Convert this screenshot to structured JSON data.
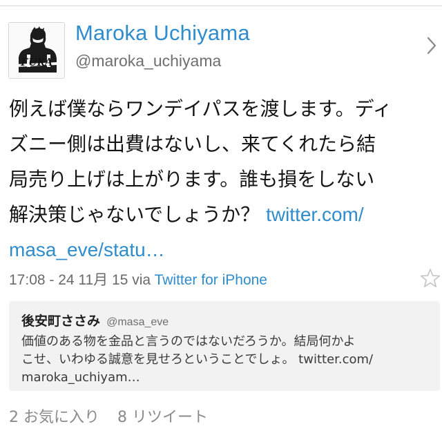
{
  "tweet": {
    "author_name": "Maroka Uchiyama",
    "author_handle": "@maroka_uchiyama",
    "text_lines": [
      "例えば僕ならワンデイパスを渡します。ディ",
      "ズニー側は出費はないし、来てくれたら結",
      "局売り上げは上がります。誰も損をしない",
      "解決策じゃないでしょうか？"
    ],
    "link_part1": "twitter.com/",
    "link_part2": "masa_eve/statu…",
    "timestamp": "17:08 - 24 11月 15",
    "via_label": "via",
    "via_app": "Twitter for iPhone"
  },
  "avatar": {
    "logo_text": "FUKA"
  },
  "quoted": {
    "name": "後安町ささみ",
    "handle": "@masa_eve",
    "text_lines": [
      "価値のある物を金品と言うのではないだろうか。結局何かよ",
      "こせ、いわゆる誠意を見せろということでしょ。 twitter.com/",
      "maroka_uchiyam…"
    ]
  },
  "stats": {
    "favorites": "2 お気に入り",
    "retweets": "8 リツイート"
  },
  "colors": {
    "accent": "#2f8ccd",
    "secondary_text": "#6f6f6f",
    "quote_bg": "#f2f2f2"
  },
  "icons": [
    "chevron-right-icon",
    "star-icon"
  ]
}
